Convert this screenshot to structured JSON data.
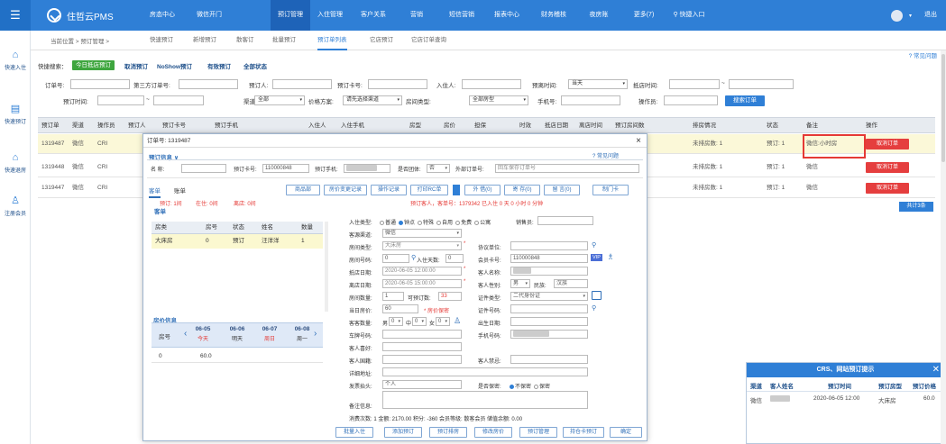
{
  "topbar": {
    "app_name": "住哲云PMS",
    "nav": [
      "房态中心",
      "微信开门",
      "预订管理",
      "入住管理",
      "客户关系",
      "营销",
      "短信营销",
      "报表中心",
      "财务稽核",
      "夜房账",
      "更多(7)",
      "快捷入口"
    ],
    "active_nav": "预订管理",
    "logout": "退出"
  },
  "sidebar": {
    "items": [
      "快速入住",
      "快速预订",
      "快速退房",
      "注册会员"
    ]
  },
  "breadcrumb": "当前位置 > 预订管理 >",
  "page_tabs": [
    "快速预订",
    "新增预订",
    "散客订",
    "批量预订",
    "预订单列表",
    "它店预订",
    "它店订单查询"
  ],
  "active_page_tab": "预订单列表",
  "help": "常见问题",
  "filter": {
    "quick_search": "快捷搜索：",
    "quick_today": "今日抵店预订",
    "quick_links": [
      "取消预订",
      "NoShow预订",
      "有效预订",
      "全部状态"
    ],
    "labels": {
      "order_no": "订单号:",
      "third_order": "第三方订单号:",
      "booker": "预订人:",
      "booking_card": "预订卡号:",
      "checkin_person": "入住人:",
      "booking_time": "预订时间:",
      "arrival_time": "抵店时间:",
      "leave_time": "预离时间:",
      "channel": "渠道:",
      "price_plan": "价格方案:",
      "room_type": "房间类型:",
      "phone": "手机号:",
      "operator": "操作员:"
    },
    "booking_time_value": "当天",
    "channel_value": "全部",
    "price_plan_value": "请先选择渠道",
    "room_type_value": "全部房型",
    "search_button": "搜索订单"
  },
  "table": {
    "headers": [
      "预订单",
      "渠道",
      "操作员",
      "预订人",
      "预订卡号",
      "预订手机",
      "入住人",
      "入住手机",
      "房型",
      "房价",
      "担保",
      "时效",
      "抵店日期",
      "离店时间",
      "预订房间数",
      "排房情况",
      "状态",
      "备注",
      "操作"
    ],
    "rows": [
      {
        "id": "1319487",
        "channel": "微信",
        "operator": "CRI",
        "rooms": "未排房数: 1",
        "status": "预订: 1",
        "note": "微信:小时房",
        "action": "取消订单"
      },
      {
        "id": "1319448",
        "channel": "微信",
        "operator": "CRI",
        "rooms": "未排房数: 1",
        "status": "预订: 1",
        "note": "微信",
        "action": "取消订单"
      },
      {
        "id": "1319447",
        "channel": "微信",
        "operator": "CRI",
        "rooms": "未排房数: 1",
        "status": "预订: 1",
        "note": "微信",
        "action": "取消订单"
      }
    ],
    "total": "共计3条"
  },
  "modal": {
    "title": "订单号: 1319487",
    "section_booking": "预订信息",
    "help": "常见问题",
    "name_label": "名  称:",
    "card_label": "预订卡号:",
    "card_value": "110000848",
    "phone_label": "预订手机:",
    "group_label": "是否团体:",
    "group_value": "否",
    "ext_order_label": "外部订单号:",
    "ext_order_placeholder": "回车保存订单号",
    "tabs": [
      "客单",
      "账单"
    ],
    "buttons": [
      "商品部",
      "房价变更记录",
      "操作记录",
      "打印RC单",
      "外 借(0)",
      "寄 存(0)",
      "留 言(0)",
      "制门卡"
    ],
    "stats": [
      "预订: 1间",
      "在住: 0间",
      "离店: 0间"
    ],
    "booker_info": "预订客人，客单号：1379342 已入住 0 天 0 小时 0 分钟",
    "guest_section": "客单",
    "room_headers": [
      "房类",
      "房号",
      "状态",
      "姓名",
      "数量"
    ],
    "room_row": [
      "大床房",
      "0",
      "预订",
      "汪洋洋",
      "1"
    ],
    "price_section": "房价信息",
    "price_head_label": "房号",
    "price_days": [
      {
        "date": "06-05",
        "sub": "今天"
      },
      {
        "date": "06-06",
        "sub": "明天"
      },
      {
        "date": "06-07",
        "sub": "周日"
      },
      {
        "date": "06-08",
        "sub": "周一"
      }
    ],
    "price_row": [
      "0",
      "60.0"
    ],
    "form": {
      "checkin_type_label": "入住类型:",
      "checkin_types": [
        "普通",
        "钟点",
        "特殊",
        "自用",
        "免费",
        "公寓"
      ],
      "sales_label": "销售员:",
      "source_label": "客源渠道:",
      "source_value": "微信",
      "room_type_label": "房间类型:",
      "room_type_value": "大床房",
      "agreement_label": "协议单位:",
      "room_no_label": "房间号码:",
      "room_no_value": "0",
      "days_label": "入住天数:",
      "days_value": "0",
      "member_card_label": "会员卡号:",
      "member_card_value": "110000848",
      "vip": "VIP",
      "arrive_label": "抵店日期:",
      "arrive_value": "2020-06-05 12:00:00",
      "guest_name_label": "客人名称:",
      "leave_label": "离店日期:",
      "leave_value": "2020-06-05 15:00:00",
      "gender_label": "客人性别:",
      "gender_value": "男",
      "nation_label": "民族:",
      "nation_value": "汉族",
      "count_label": "房间数量:",
      "count_value": "1",
      "avail_label": "可预订数:",
      "avail_value": "33",
      "id_type_label": "证件类型:",
      "id_type_value": "二代身份证",
      "price_label": "当日房价:",
      "price_value": "60",
      "price_secret": "房价保密",
      "id_no_label": "证件号码:",
      "guests_label": "客客数量:",
      "guest_m": "男",
      "guest_mid": "中",
      "guest_f": "女",
      "guest_m_val": "0",
      "guest_mid_val": "0",
      "guest_f_val": "0",
      "birthday_label": "出生日期:",
      "plate_label": "车牌号码:",
      "mobile_label": "手机号码:",
      "hobby_label": "客人喜好:",
      "remark_label": "客人国籍:",
      "avoid_label": "客人禁忌:",
      "address_label": "详细地址:",
      "invoice_label": "发票抬头:",
      "invoice_value": "个人",
      "secret_label": "是否保密:",
      "secret_options": [
        "不保密",
        "保密"
      ],
      "note_label": "备注信息:",
      "summary": "消费次数: 1 金额: 2170.00 积分: -360 会员等级: 散客会员 储值余额: 0.00"
    },
    "footer_buttons": [
      "批量入住",
      "添加预订",
      "预订排房",
      "修改房价",
      "预订管理",
      "持仓卡预订",
      "确定"
    ]
  },
  "popup": {
    "title": "CRS、网站预订提示",
    "headers": [
      "渠道",
      "客人姓名",
      "预订时间",
      "预订房型",
      "预订价格"
    ],
    "row": {
      "channel": "微信",
      "time": "2020-06-05 12:00",
      "room": "大床房",
      "price": "60.0"
    }
  }
}
